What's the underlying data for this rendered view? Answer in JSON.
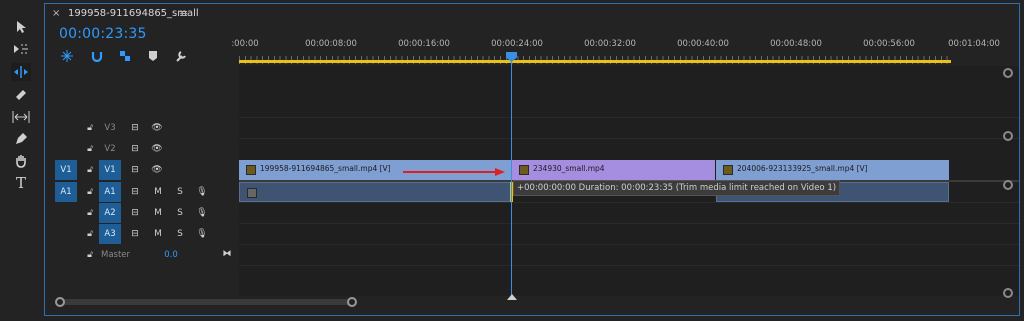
{
  "tab": {
    "close": "×",
    "title": "199958-911694865_small",
    "menu": "≡"
  },
  "timecode": "00:00:23:35",
  "ruler_labels": [
    ":00:00",
    "00:00:08:00",
    "00:00:16:00",
    "00:00:24:00",
    "00:00:32:00",
    "00:00:40:00",
    "00:00:48:00",
    "00:00:56:00",
    "00:01:04:00"
  ],
  "tracks": {
    "v3": {
      "name": "V3"
    },
    "v2": {
      "name": "V2"
    },
    "v1": {
      "source": "V1",
      "name": "V1"
    },
    "a1": {
      "source": "A1",
      "name": "A1",
      "mute": "M",
      "solo": "S"
    },
    "a2": {
      "name": "A2",
      "mute": "M",
      "solo": "S"
    },
    "a3": {
      "name": "A3",
      "mute": "M",
      "solo": "S"
    },
    "master": {
      "label": "Master",
      "value": "0.0"
    }
  },
  "clips": {
    "clip1": "199958-911694865_small.mp4 [V]",
    "clip2": "234930_small.mp4",
    "clip3": "204006-923133925_small.mp4 [V]"
  },
  "tooltip": "+00:00:00:00 Duration: 00:00:23:35 (Trim media limit reached on Video 1)",
  "colors": {
    "accent": "#2f9bff",
    "panel_border": "#2d6fb2",
    "clip_blue": "#7f9ed2",
    "clip_purple": "#a58ee0",
    "audio_clip": "#3f5472",
    "work_area": "#e8c21a",
    "arrow": "#e02020"
  }
}
